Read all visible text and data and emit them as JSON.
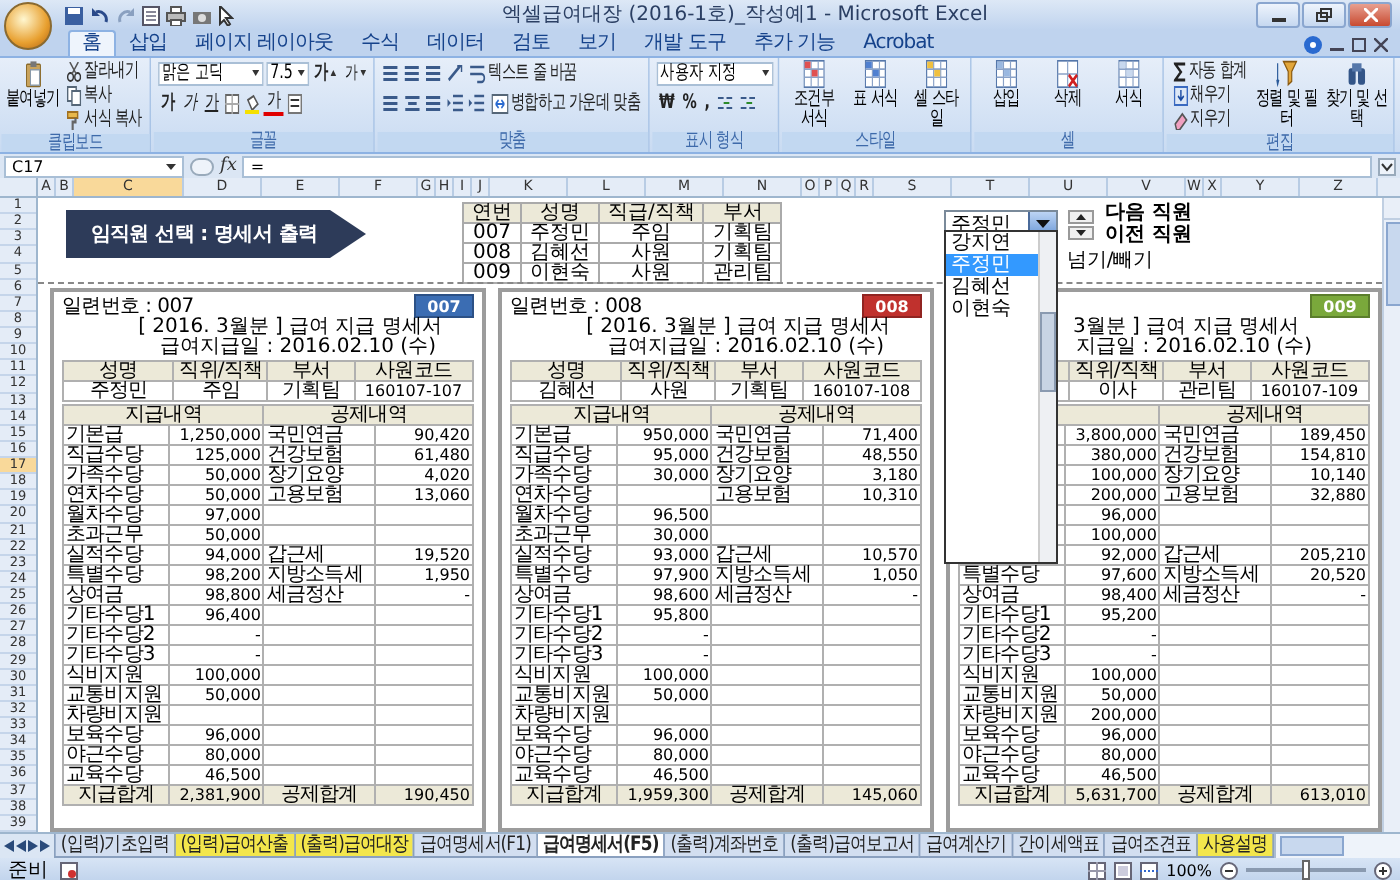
{
  "window": {
    "title": "엑셀급여대장 (2016-1호)_작성예1 - Microsoft Excel"
  },
  "ribbon_tabs": [
    {
      "label": "홈",
      "selected": true
    },
    {
      "label": "삽입",
      "selected": false
    },
    {
      "label": "페이지 레이아웃",
      "selected": false
    },
    {
      "label": "수식",
      "selected": false
    },
    {
      "label": "데이터",
      "selected": false
    },
    {
      "label": "검토",
      "selected": false
    },
    {
      "label": "보기",
      "selected": false
    },
    {
      "label": "개발 도구",
      "selected": false
    },
    {
      "label": "추가 기능",
      "selected": false
    },
    {
      "label": "Acrobat",
      "selected": false
    }
  ],
  "ribbon_groups": [
    {
      "kind": "clipboard",
      "label": "클립보드",
      "big": "붙여넣기",
      "small": [
        "잘라내기",
        "복사",
        "서식 복사"
      ]
    },
    {
      "kind": "font",
      "label": "글꼴",
      "font": "맑은 고딕",
      "size": "7.5",
      "grow": "가",
      "shrink": "가",
      "styles": [
        "가",
        "가",
        "가"
      ],
      "color_button": "가"
    },
    {
      "kind": "alignment",
      "label": "맞춤",
      "wrap": "텍스트 줄 바꿈",
      "merge": "병합하고 가운데 맞춤"
    },
    {
      "kind": "number",
      "label": "표시 형식",
      "format": "사용자 지정",
      "symbols": [
        "₩",
        "%",
        ","
      ]
    },
    {
      "kind": "large",
      "label": "스타일",
      "buttons": [
        "조건부 서식",
        "표 서식",
        "셀 스타일"
      ]
    },
    {
      "kind": "large",
      "label": "셀",
      "buttons": [
        "삽입",
        "삭제",
        "서식"
      ]
    },
    {
      "kind": "edit",
      "label": "편집",
      "small": [
        "자동 합계",
        "채우기",
        "지우기"
      ],
      "buttons": [
        "정렬 및 필터",
        "찾기 및 선택"
      ]
    }
  ],
  "formula_bar": {
    "name_box": "C17",
    "fx": "fx",
    "formula": "="
  },
  "columns": [
    {
      "label": "A",
      "selected": false
    },
    {
      "label": "B",
      "selected": false
    },
    {
      "label": "C",
      "selected": true
    },
    {
      "label": "D",
      "selected": false
    },
    {
      "label": "E",
      "selected": false
    },
    {
      "label": "F",
      "selected": false
    },
    {
      "label": "G",
      "selected": false
    },
    {
      "label": "H",
      "selected": false
    },
    {
      "label": "I",
      "selected": false
    },
    {
      "label": "J",
      "selected": false
    },
    {
      "label": "K",
      "selected": false
    },
    {
      "label": "L",
      "selected": false
    },
    {
      "label": "M",
      "selected": false
    },
    {
      "label": "N",
      "selected": false
    },
    {
      "label": "O",
      "selected": false
    },
    {
      "label": "P",
      "selected": false
    },
    {
      "label": "Q",
      "selected": false
    },
    {
      "label": "R",
      "selected": false
    },
    {
      "label": "S",
      "selected": false
    },
    {
      "label": "T",
      "selected": false
    },
    {
      "label": "U",
      "selected": false
    },
    {
      "label": "V",
      "selected": false
    },
    {
      "label": "W",
      "selected": false
    },
    {
      "label": "X",
      "selected": false
    },
    {
      "label": "Y",
      "selected": false
    },
    {
      "label": "Z",
      "selected": false
    }
  ],
  "rows": [
    {
      "label": "1",
      "selected": false
    },
    {
      "label": "2",
      "selected": false
    },
    {
      "label": "3",
      "selected": false
    },
    {
      "label": "4",
      "selected": false
    },
    {
      "label": "5",
      "selected": false
    },
    {
      "label": "6",
      "selected": false
    },
    {
      "label": "7",
      "selected": false
    },
    {
      "label": "8",
      "selected": false
    },
    {
      "label": "9",
      "selected": false
    },
    {
      "label": "10",
      "selected": false
    },
    {
      "label": "11",
      "selected": false
    },
    {
      "label": "12",
      "selected": false
    },
    {
      "label": "13",
      "selected": false
    },
    {
      "label": "14",
      "selected": false
    },
    {
      "label": "15",
      "selected": false
    },
    {
      "label": "16",
      "selected": false
    },
    {
      "label": "17",
      "selected": true
    },
    {
      "label": "18",
      "selected": false
    },
    {
      "label": "19",
      "selected": false
    },
    {
      "label": "20",
      "selected": false
    },
    {
      "label": "21",
      "selected": false
    },
    {
      "label": "22",
      "selected": false
    },
    {
      "label": "23",
      "selected": false
    },
    {
      "label": "24",
      "selected": false
    },
    {
      "label": "25",
      "selected": false
    },
    {
      "label": "26",
      "selected": false
    },
    {
      "label": "27",
      "selected": false
    },
    {
      "label": "28",
      "selected": false
    },
    {
      "label": "29",
      "selected": false
    },
    {
      "label": "30",
      "selected": false
    },
    {
      "label": "31",
      "selected": false
    },
    {
      "label": "32",
      "selected": false
    },
    {
      "label": "33",
      "selected": false
    },
    {
      "label": "34",
      "selected": false
    },
    {
      "label": "35",
      "selected": false
    },
    {
      "label": "36",
      "selected": false
    },
    {
      "label": "37",
      "selected": false
    },
    {
      "label": "38",
      "selected": false
    },
    {
      "label": "39",
      "selected": false
    }
  ],
  "sheet": {
    "banner": "임직원 선택 : 명세서 출력",
    "lookup": {
      "columns": [
        "연번",
        "성명",
        "직급/직책",
        "부서"
      ],
      "rows": [
        [
          "007",
          "주정민",
          "주임",
          "기획팀"
        ],
        [
          "008",
          "김혜선",
          "사원",
          "기획팀"
        ],
        [
          "009",
          "이현숙",
          "사원",
          "관리팀"
        ]
      ]
    },
    "selector": {
      "value": "주정민",
      "options": [
        {
          "label": "강지연",
          "selected": false
        },
        {
          "label": "주정민",
          "selected": true
        },
        {
          "label": "김혜선",
          "selected": false
        },
        {
          "label": "이현숙",
          "selected": false
        }
      ],
      "next": "다음 직원",
      "prev": "이전 직원",
      "note": "넘기/빼기"
    },
    "slips": [
      {
        "serial": "일련번호 : 007",
        "badge": "007",
        "color": "#3b6db3",
        "title": "[ 2016. 3월분 ] 급여 지급 명세서",
        "date": "급여지급일 : 2016.02.10 (수)",
        "info": [
          {
            "header": "성명",
            "value": "주정민"
          },
          {
            "header": "직위/직책",
            "value": "주임"
          },
          {
            "header": "부서",
            "value": "기획팀"
          },
          {
            "header": "사원코드",
            "value": "160107-107"
          }
        ],
        "pay_header": "지급내역",
        "deduction_header": "공제내역",
        "rows": [
          {
            "pay_label": "기본급",
            "pay_amount": "1,250,000",
            "ded_label": "국민연금",
            "ded_amount": "90,420"
          },
          {
            "pay_label": "직급수당",
            "pay_amount": "125,000",
            "ded_label": "건강보험",
            "ded_amount": "61,480"
          },
          {
            "pay_label": "가족수당",
            "pay_amount": "50,000",
            "ded_label": "장기요양",
            "ded_amount": "4,020"
          },
          {
            "pay_label": "연차수당",
            "pay_amount": "50,000",
            "ded_label": "고용보험",
            "ded_amount": "13,060"
          },
          {
            "pay_label": "월차수당",
            "pay_amount": "97,000"
          },
          {
            "pay_label": "초과근무",
            "pay_amount": "50,000"
          },
          {
            "pay_label": "실적수당",
            "pay_amount": "94,000",
            "ded_label": "갑근세",
            "ded_amount": "19,520"
          },
          {
            "pay_label": "특별수당",
            "pay_amount": "98,200",
            "ded_label": "지방소득세",
            "ded_amount": "1,950"
          },
          {
            "pay_label": "상여금",
            "pay_amount": "98,800",
            "ded_label": "세금정산",
            "ded_amount": "-"
          },
          {
            "pay_label": "기타수당1",
            "pay_amount": "96,400"
          },
          {
            "pay_label": "기타수당2",
            "pay_amount": "-"
          },
          {
            "pay_label": "기타수당3",
            "pay_amount": "-"
          },
          {
            "pay_label": "식비지원",
            "pay_amount": "100,000"
          },
          {
            "pay_label": "교통비지원",
            "pay_amount": "50,000"
          },
          {
            "pay_label": "차량비지원"
          },
          {
            "pay_label": "보육수당",
            "pay_amount": "96,000"
          },
          {
            "pay_label": "야근수당",
            "pay_amount": "80,000"
          },
          {
            "pay_label": "교육수당",
            "pay_amount": "46,500"
          }
        ],
        "total": {
          "pay_label": "지급합계",
          "pay_amount": "2,381,900",
          "ded_label": "공제합계",
          "ded_amount": "190,450"
        }
      },
      {
        "serial": "일련번호 : 008",
        "badge": "008",
        "color": "#c0312d",
        "title": "[ 2016. 3월분 ] 급여 지급 명세서",
        "date": "급여지급일 : 2016.02.10 (수)",
        "info": [
          {
            "header": "성명",
            "value": "김혜선"
          },
          {
            "header": "직위/직책",
            "value": "사원"
          },
          {
            "header": "부서",
            "value": "기획팀"
          },
          {
            "header": "사원코드",
            "value": "160107-108"
          }
        ],
        "pay_header": "지급내역",
        "deduction_header": "공제내역",
        "rows": [
          {
            "pay_label": "기본급",
            "pay_amount": "950,000",
            "ded_label": "국민연금",
            "ded_amount": "71,400"
          },
          {
            "pay_label": "직급수당",
            "pay_amount": "95,000",
            "ded_label": "건강보험",
            "ded_amount": "48,550"
          },
          {
            "pay_label": "가족수당",
            "pay_amount": "30,000",
            "ded_label": "장기요양",
            "ded_amount": "3,180"
          },
          {
            "pay_label": "연차수당",
            "ded_label": "고용보험",
            "ded_amount": "10,310"
          },
          {
            "pay_label": "월차수당",
            "pay_amount": "96,500"
          },
          {
            "pay_label": "초과근무",
            "pay_amount": "30,000"
          },
          {
            "pay_label": "실적수당",
            "pay_amount": "93,000",
            "ded_label": "갑근세",
            "ded_amount": "10,570"
          },
          {
            "pay_label": "특별수당",
            "pay_amount": "97,900",
            "ded_label": "지방소득세",
            "ded_amount": "1,050"
          },
          {
            "pay_label": "상여금",
            "pay_amount": "98,600",
            "ded_label": "세금정산",
            "ded_amount": "-"
          },
          {
            "pay_label": "기타수당1",
            "pay_amount": "95,800"
          },
          {
            "pay_label": "기타수당2",
            "pay_amount": "-"
          },
          {
            "pay_label": "기타수당3",
            "pay_amount": "-"
          },
          {
            "pay_label": "식비지원",
            "pay_amount": "100,000"
          },
          {
            "pay_label": "교통비지원",
            "pay_amount": "50,000"
          },
          {
            "pay_label": "차량비지원"
          },
          {
            "pay_label": "보육수당",
            "pay_amount": "96,000"
          },
          {
            "pay_label": "야근수당",
            "pay_amount": "80,000"
          },
          {
            "pay_label": "교육수당",
            "pay_amount": "46,500"
          }
        ],
        "total": {
          "pay_label": "지급합계",
          "pay_amount": "1,959,300",
          "ded_label": "공제합계",
          "ded_amount": "145,060"
        }
      },
      {
        "badge": "009",
        "color": "#7aa83b",
        "title": "3월분 ] 급여 지급 명세서",
        "date": "지급일 : 2016.02.10 (수)",
        "info": [
          {
            "header": "직위/직책",
            "value": "이사"
          },
          {
            "header": "부서",
            "value": "관리팀"
          },
          {
            "header": "사원코드",
            "value": "160107-109"
          }
        ],
        "deduction_header": "공제내역",
        "rows": [
          {
            "pay_amount": "3,800,000",
            "ded_label": "국민연금",
            "ded_amount": "189,450"
          },
          {
            "pay_amount": "380,000",
            "ded_label": "건강보험",
            "ded_amount": "154,810"
          },
          {
            "pay_amount": "100,000",
            "ded_label": "장기요양",
            "ded_amount": "10,140"
          },
          {
            "pay_amount": "200,000",
            "ded_label": "고용보험",
            "ded_amount": "32,880"
          },
          {
            "pay_amount": "96,000"
          },
          {
            "pay_amount": "100,000"
          },
          {
            "pay_amount": "92,000",
            "ded_label": "갑근세",
            "ded_amount": "205,210"
          },
          {
            "pay_label": "특별수당",
            "pay_amount": "97,600",
            "ded_label": "지방소득세",
            "ded_amount": "20,520"
          },
          {
            "pay_label": "상여금",
            "pay_amount": "98,400",
            "ded_label": "세금정산",
            "ded_amount": "-"
          },
          {
            "pay_label": "기타수당1",
            "pay_amount": "95,200"
          },
          {
            "pay_label": "기타수당2",
            "pay_amount": "-"
          },
          {
            "pay_label": "기타수당3",
            "pay_amount": "-"
          },
          {
            "pay_label": "식비지원",
            "pay_amount": "100,000"
          },
          {
            "pay_label": "교통비지원",
            "pay_amount": "50,000"
          },
          {
            "pay_label": "차량비지원",
            "pay_amount": "200,000"
          },
          {
            "pay_label": "보육수당",
            "pay_amount": "96,000"
          },
          {
            "pay_label": "야근수당",
            "pay_amount": "80,000"
          },
          {
            "pay_label": "교육수당",
            "pay_amount": "46,500"
          }
        ],
        "total": {
          "pay_label": "지급합계",
          "pay_amount": "5,631,700",
          "ded_label": "공제합계",
          "ded_amount": "613,010"
        }
      }
    ]
  },
  "sheet_tabs": [
    {
      "label": "(입력)기초입력",
      "selected": false
    },
    {
      "label": "(입력)급여산출",
      "selected": false,
      "color": "#f3e64c"
    },
    {
      "label": "(출력)급여대장",
      "selected": false,
      "color": "#f3e64c"
    },
    {
      "label": "급여명세서(F1)",
      "selected": false
    },
    {
      "label": "급여명세서(F5)",
      "selected": true
    },
    {
      "label": "(출력)계좌번호",
      "selected": false
    },
    {
      "label": "(출력)급여보고서",
      "selected": false
    },
    {
      "label": "급여계산기",
      "selected": false
    },
    {
      "label": "간이세액표",
      "selected": false
    },
    {
      "label": "급여조견표",
      "selected": false
    },
    {
      "label": "사용설명",
      "selected": false,
      "color": "#f3e64c"
    }
  ],
  "status_bar": {
    "mode": "준비",
    "zoom": "100%",
    "zoom_slider": {
      "level": 0.5
    }
  }
}
